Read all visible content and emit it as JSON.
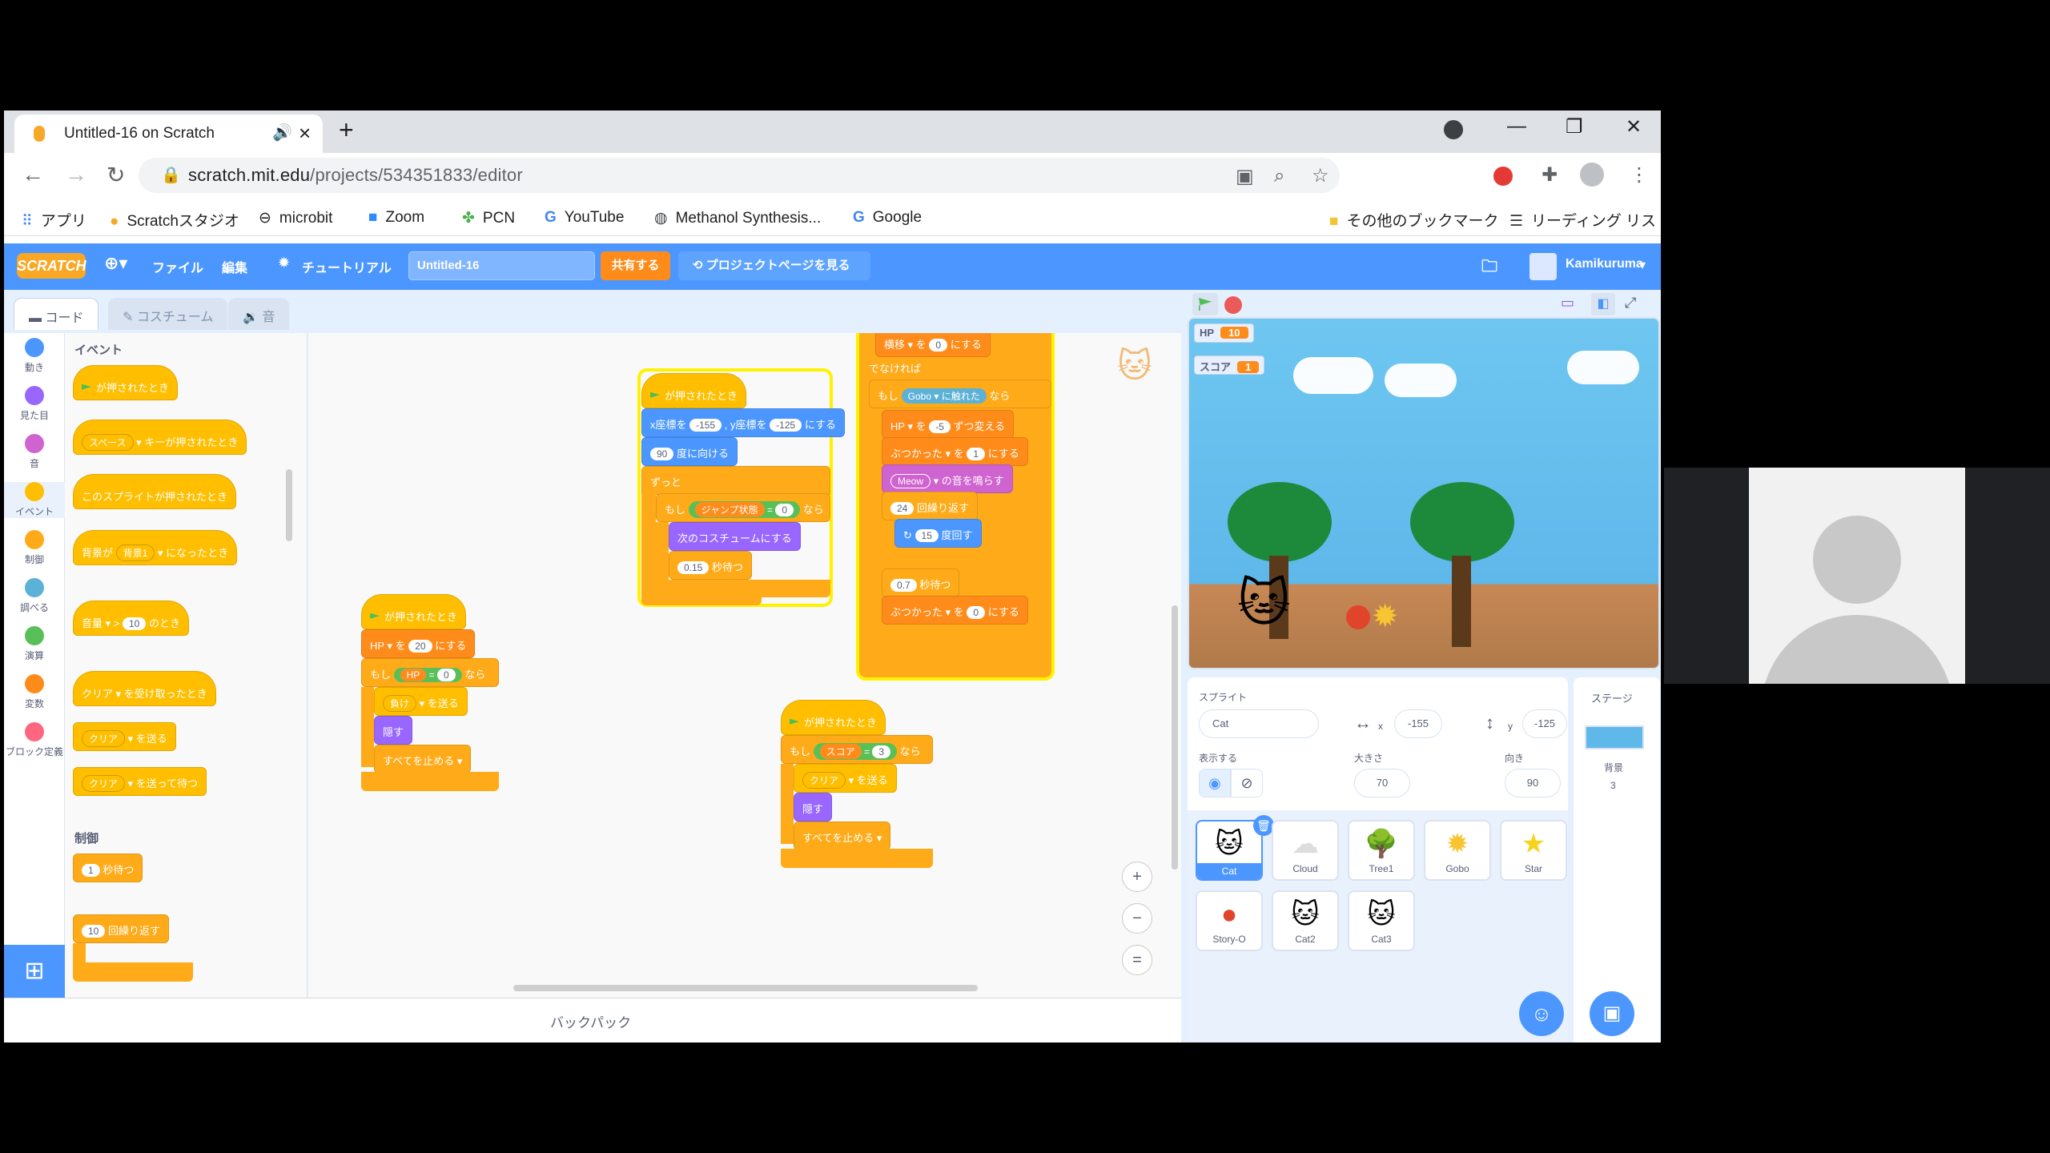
{
  "browser": {
    "tab_title": "Untitled-16 on Scratch",
    "url_host": "scratch.mit.edu",
    "url_path": "/projects/534351833/editor",
    "bookmarks": [
      "アプリ",
      "Scratchスタジオ",
      "microbit",
      "Zoom",
      "PCN",
      "YouTube",
      "Methanol Synthesis...",
      "Google"
    ],
    "other_bookmarks": "その他のブックマーク",
    "reading_list": "リーディング リスト"
  },
  "menu": {
    "logo": "SCRATCH",
    "file": "ファイル",
    "edit": "編集",
    "tutorial": "チュートリアル",
    "project_title": "Untitled-16",
    "share": "共有する",
    "see_project": "プロジェクトページを見る",
    "username": "Kamikuruma"
  },
  "tabs": {
    "code": "コード",
    "costume": "コスチューム",
    "sound": "音"
  },
  "categories": [
    {
      "label": "動き",
      "color": "#4c97ff"
    },
    {
      "label": "見た目",
      "color": "#9966ff"
    },
    {
      "label": "音",
      "color": "#cf63cf"
    },
    {
      "label": "イベント",
      "color": "#ffbf00"
    },
    {
      "label": "制御",
      "color": "#ffab19"
    },
    {
      "label": "調べる",
      "color": "#5cb1d6"
    },
    {
      "label": "演算",
      "color": "#59c059"
    },
    {
      "label": "変数",
      "color": "#ff8c1a"
    },
    {
      "label": "ブロック定義",
      "color": "#ff6680"
    }
  ],
  "palette": {
    "events_header": "イベント",
    "flag_clicked": "が押されたとき",
    "key_space": "スペース",
    "key_pressed": "キーが押されたとき",
    "sprite_clicked": "このスプライトが押されたとき",
    "backdrop_label": "背景が",
    "backdrop_value": "背景1",
    "backdrop_switch": "になったとき",
    "volume": "音量",
    "volume_value": "10",
    "volume_when": "のとき",
    "clear": "クリア",
    "received": "を受け取ったとき",
    "broadcast": "を送る",
    "broadcast_wait": "を送って待つ",
    "control_header": "制御",
    "wait_value": "1",
    "wait_label": "秒待つ",
    "repeat_value": "10",
    "repeat_label": "回繰り返す"
  },
  "scripts": {
    "s1": {
      "hat": "が押されたとき",
      "x_label": "x座標を",
      "x": "-155",
      "y_label": "y座標を",
      "y": "-125",
      "goto_end": "にする",
      "dir": "90",
      "dir_label": "度に向ける",
      "forever": "ずっと",
      "if": "もし",
      "jump": "ジャンプ状態",
      "eq": "=",
      "zero": "0",
      "then": "なら",
      "next_costume": "次のコスチュームにする",
      "wait": "0.15",
      "wait_label": "秒待つ"
    },
    "s2": {
      "top_var": "横移",
      "top_val": "0",
      "top_end": "にする",
      "else": "でなければ",
      "if": "もし",
      "gobo": "Gobo",
      "touch": "に触れた",
      "then": "なら",
      "hp": "HP",
      "by": "を",
      "hp_val": "-5",
      "change": "ずつ変える",
      "hit": "ぶつかった",
      "hit_val": "1",
      "set": "にする",
      "meow": "Meow",
      "play": "の音を鳴らす",
      "rep": "24",
      "rep_label": "回繰り返す",
      "turn": "15",
      "turn_label": "度回す",
      "wait": "0.7",
      "wait_label": "秒待つ",
      "hit2_val": "0"
    },
    "s3": {
      "hat": "が押されたとき",
      "hp": "HP",
      "to": "を",
      "hp_val": "20",
      "set": "にする",
      "if": "もし",
      "hp2": "HP",
      "eq": "=",
      "zero": "0",
      "then": "なら",
      "lose": "負け",
      "send": "を送る",
      "hide": "隠す",
      "stop": "すべてを止める"
    },
    "s4": {
      "hat": "が押されたとき",
      "if": "もし",
      "score": "スコア",
      "eq": "=",
      "three": "3",
      "then": "なら",
      "clear": "クリア",
      "send": "を送る",
      "hide": "隠す",
      "stop": "すべてを止める"
    }
  },
  "backpack": "バックパック",
  "stage": {
    "hp_label": "HP",
    "hp_value": "10",
    "score_label": "スコア",
    "score_value": "1"
  },
  "sprite_info": {
    "sprite_label": "スプライト",
    "sprite_name": "Cat",
    "x_label": "x",
    "x": "-155",
    "y_label": "y",
    "y": "-125",
    "show_label": "表示する",
    "size_label": "大きさ",
    "size": "70",
    "dir_label": "向き",
    "dir": "90"
  },
  "sprites": [
    {
      "name": "Cat"
    },
    {
      "name": "Cloud"
    },
    {
      "name": "Tree1"
    },
    {
      "name": "Gobo"
    },
    {
      "name": "Star"
    },
    {
      "name": "Story-O"
    },
    {
      "name": "Cat2"
    },
    {
      "name": "Cat3"
    }
  ],
  "stage_panel": {
    "title": "ステージ",
    "backdrops_label": "背景",
    "backdrops_count": "3"
  }
}
